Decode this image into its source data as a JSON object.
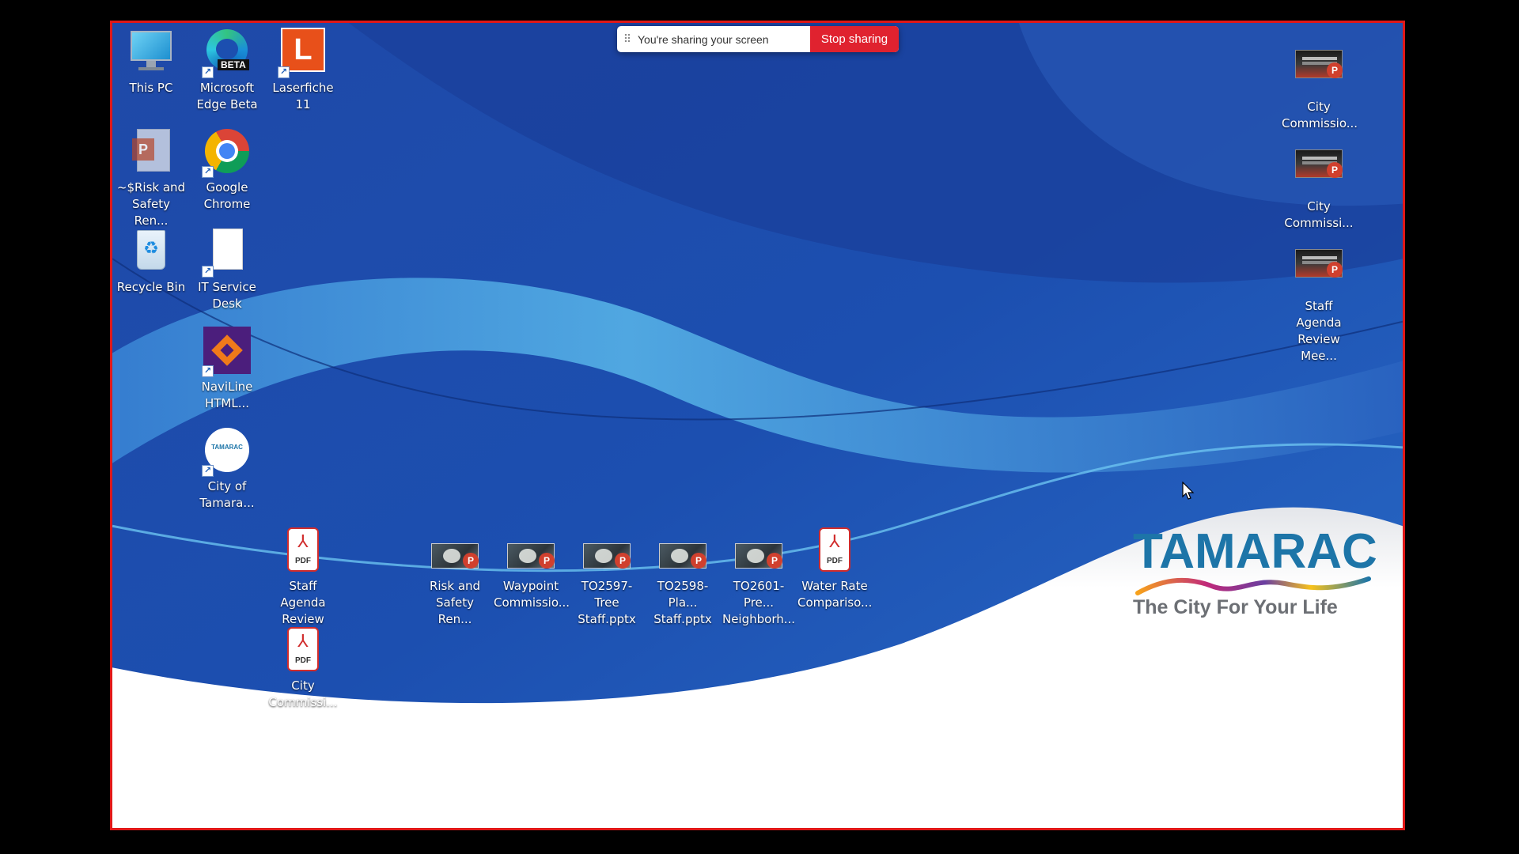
{
  "screen_share": {
    "message": "You're sharing your screen",
    "stop_label": "Stop sharing",
    "stop_color": "#e0222f"
  },
  "desktop": {
    "frame_border_color": "#e01818",
    "left_icons": [
      {
        "label": "This PC",
        "icon": "monitor-icon"
      },
      {
        "label": "Microsoft Edge Beta",
        "icon": "edge-beta-icon",
        "badge": "BETA"
      },
      {
        "label": "Laserfiche 11",
        "icon": "laserfiche-icon",
        "glyph": "L"
      },
      {
        "label": "~$Risk and Safety Ren...",
        "icon": "powerpoint-icon"
      },
      {
        "label": "Google Chrome",
        "icon": "chrome-icon"
      },
      {
        "label": "Recycle Bin",
        "icon": "recycle-bin-icon"
      },
      {
        "label": "IT Service Desk",
        "icon": "blank-document-icon"
      },
      {
        "label": "NaviLine HTML...",
        "icon": "naviline-icon"
      },
      {
        "label": "City of Tamara...",
        "icon": "tamarac-web-icon",
        "glyph_text": "TAMARAC"
      }
    ],
    "file_icons": [
      {
        "label": "Staff Agenda Review Wo...",
        "icon": "pdf-icon",
        "tag": "PDF"
      },
      {
        "label": "City Commissi...",
        "icon": "pdf-icon",
        "tag": "PDF"
      },
      {
        "label": "Risk and Safety Ren...",
        "icon": "pptx-thumbnail-icon",
        "badge": "P"
      },
      {
        "label": "Waypoint Commissio...",
        "icon": "pptx-thumbnail-icon",
        "badge": "P"
      },
      {
        "label": "TO2597-Tree Staff.pptx",
        "icon": "pptx-thumbnail-icon",
        "badge": "P"
      },
      {
        "label": "TO2598-Pla... Staff.pptx",
        "icon": "pptx-thumbnail-icon",
        "badge": "P"
      },
      {
        "label": "TO2601-Pre... Neighborh...",
        "icon": "pptx-thumbnail-icon",
        "badge": "P"
      },
      {
        "label": "Water Rate Compariso...",
        "icon": "pdf-icon",
        "tag": "PDF"
      }
    ],
    "right_icons": [
      {
        "label": "City Commissio...",
        "icon": "pptx-thumbnail-icon",
        "badge": "P"
      },
      {
        "label": "City Commissi...",
        "icon": "pptx-thumbnail-icon",
        "badge": "P"
      },
      {
        "label": "Staff Agenda Review Mee...",
        "icon": "pptx-thumbnail-icon",
        "badge": "P"
      }
    ],
    "logo": {
      "brand": "TAMARAC",
      "tagline": "The City For Your Life",
      "brand_color": "#1d75a8"
    }
  }
}
